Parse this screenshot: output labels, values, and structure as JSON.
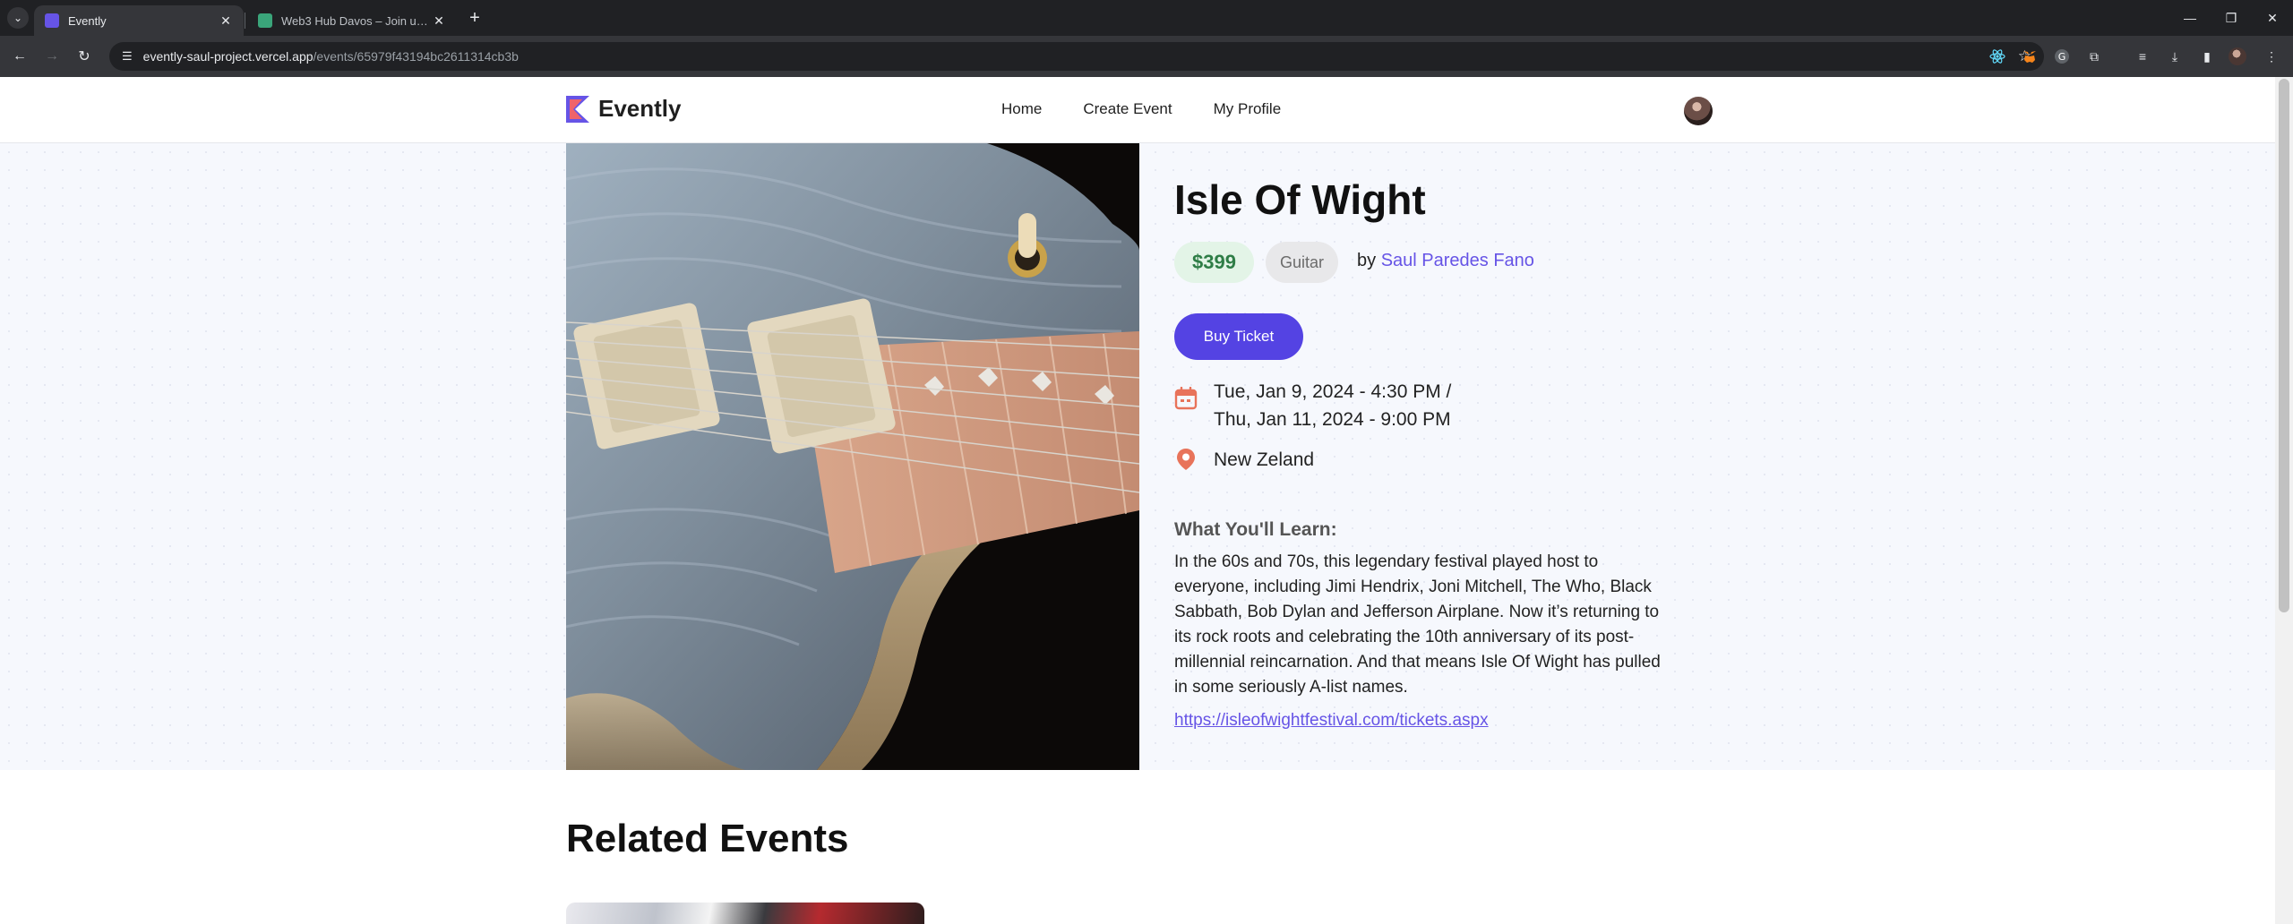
{
  "browser": {
    "tabs": [
      {
        "title": "Evently",
        "active": true,
        "favicon_color": "#6654e6"
      },
      {
        "title": "Web3 Hub Davos – Join us at the",
        "active": false,
        "favicon_color": "#3aa57a"
      }
    ],
    "url_host": "evently-saul-project.vercel.app",
    "url_path": "/events/65979f43194bc2611314cb3b"
  },
  "header": {
    "brand": "Evently",
    "nav": [
      "Home",
      "Create Event",
      "My Profile"
    ]
  },
  "event": {
    "title": "Isle Of Wight",
    "price": "$399",
    "category": "Guitar",
    "by_prefix": "by",
    "organizer": "Saul Paredes Fano",
    "buy_label": "Buy Ticket",
    "date_start": "Tue, Jan 9, 2024 - 4:30 PM /",
    "date_end": "Thu, Jan 11, 2024 - 9:00 PM",
    "location": "New Zeland",
    "learn_heading": "What You'll Learn:",
    "description": "In the 60s and 70s, this legendary festival played host to everyone, including Jimi Hendrix, Joni Mitchell, The Who, Black Sabbath, Bob Dylan and Jefferson Airplane. Now it’s returning to its rock roots and celebrating the 10th anniversary of its post-millennial reincarnation. And that means Isle Of Wight has pulled in some seriously A-list names.",
    "link": "https://isleofwightfestival.com/tickets.aspx"
  },
  "related": {
    "heading": "Related Events"
  },
  "colors": {
    "primary": "#5443e3",
    "accent_icon": "#e8735a",
    "price_bg": "#e3f4e7",
    "price_text": "#2e7d46"
  }
}
